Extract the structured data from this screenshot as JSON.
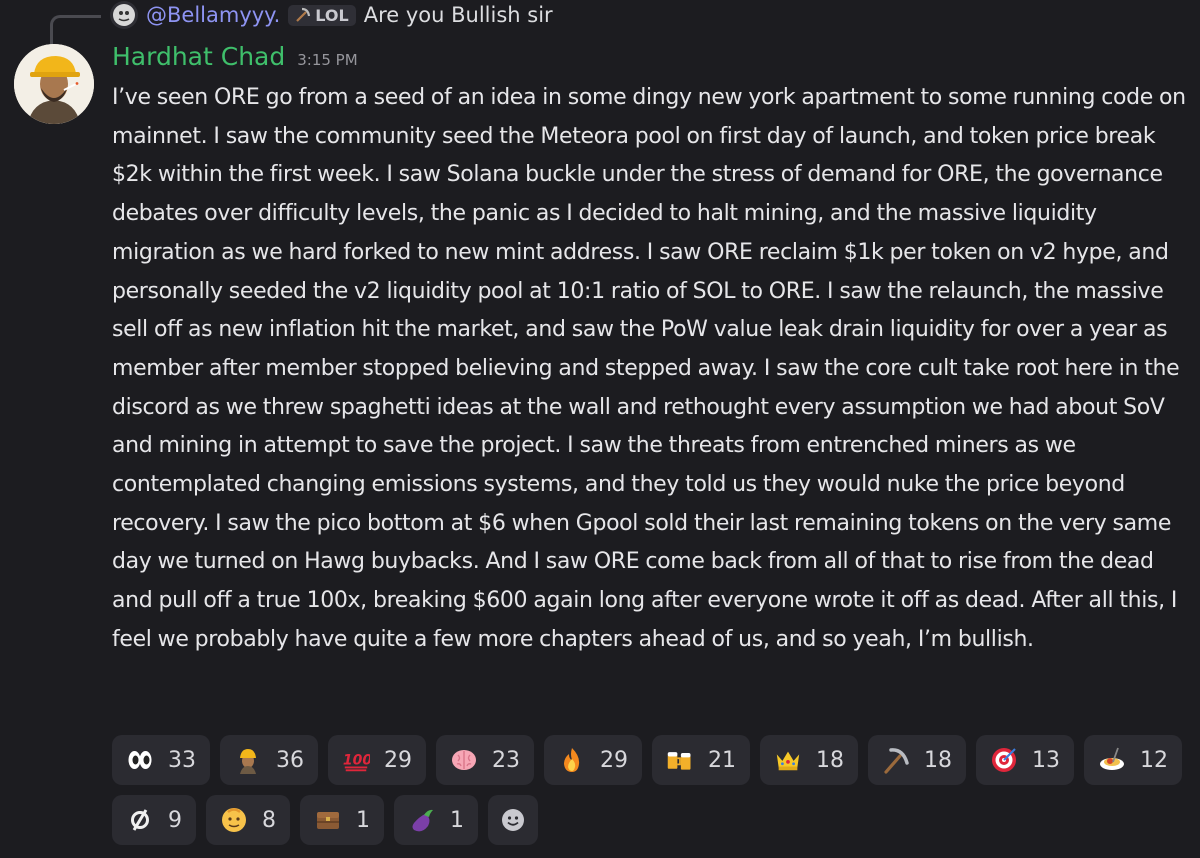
{
  "reply": {
    "username": "@Bellamyyy.",
    "role_tag": "LOL",
    "text": "Are you Bullish sir"
  },
  "message": {
    "author": "Hardhat Chad",
    "timestamp": "3:15 PM",
    "text": "I’ve seen ORE go from a seed of an idea in some dingy new york apartment to some running code on mainnet. I saw the community seed the Meteora pool on first day of launch, and token price break $2k within the first week. I saw Solana buckle under the stress of demand for ORE, the governance debates over difficulty levels, the panic as I decided to halt mining, and the massive liquidity migration as we hard forked to new mint address. I saw ORE reclaim $1k per token on v2 hype, and personally seeded the v2 liquidity pool at 10:1 ratio of SOL to ORE. I saw the relaunch, the massive sell off as new inflation hit the market, and saw the PoW value leak drain liquidity for over a year as member after member stopped believing and stepped away. I saw the core cult take root here in the discord as we threw spaghetti ideas at the wall and rethought every assumption we had about SoV and mining in attempt to save the project. I saw the threats from entrenched miners as we contemplated changing emissions systems, and they told us they would nuke the price beyond recovery. I saw the pico bottom at $6 when Gpool sold their last remaining tokens on the very same day we turned on Hawg buybacks. And I saw ORE come back from all of that to rise from the dead and pull off a true 100x, breaking $600 again long after everyone wrote it off as dead. After all this, I feel we probably have quite a few more chapters ahead of us, and so yeah, I’m bullish."
  },
  "reactions": [
    {
      "icon": "eyes-emoji-icon",
      "count": "33"
    },
    {
      "icon": "hardhat-chad-emoji-icon",
      "count": "36"
    },
    {
      "icon": "hundred-points-emoji-icon",
      "count": "29"
    },
    {
      "icon": "brain-emoji-icon",
      "count": "23"
    },
    {
      "icon": "fire-emoji-icon",
      "count": "29"
    },
    {
      "icon": "clinking-beer-mugs-emoji-icon",
      "count": "21"
    },
    {
      "icon": "crown-emoji-icon",
      "count": "18"
    },
    {
      "icon": "pick-emoji-icon",
      "count": "18"
    },
    {
      "icon": "bullseye-emoji-icon",
      "count": "13"
    },
    {
      "icon": "spaghetti-emoji-icon",
      "count": "12"
    },
    {
      "icon": "ore-logo-emoji-icon",
      "count": "9"
    },
    {
      "icon": "face-emoji-icon",
      "count": "8"
    },
    {
      "icon": "chest-emoji-icon",
      "count": "1"
    },
    {
      "icon": "eggplant-emoji-icon",
      "count": "1"
    }
  ],
  "colors": {
    "background": "#1c1c20",
    "username": "#3fbf6b",
    "reply_username": "#8e94f2",
    "reaction_bg": "#2b2b31"
  }
}
